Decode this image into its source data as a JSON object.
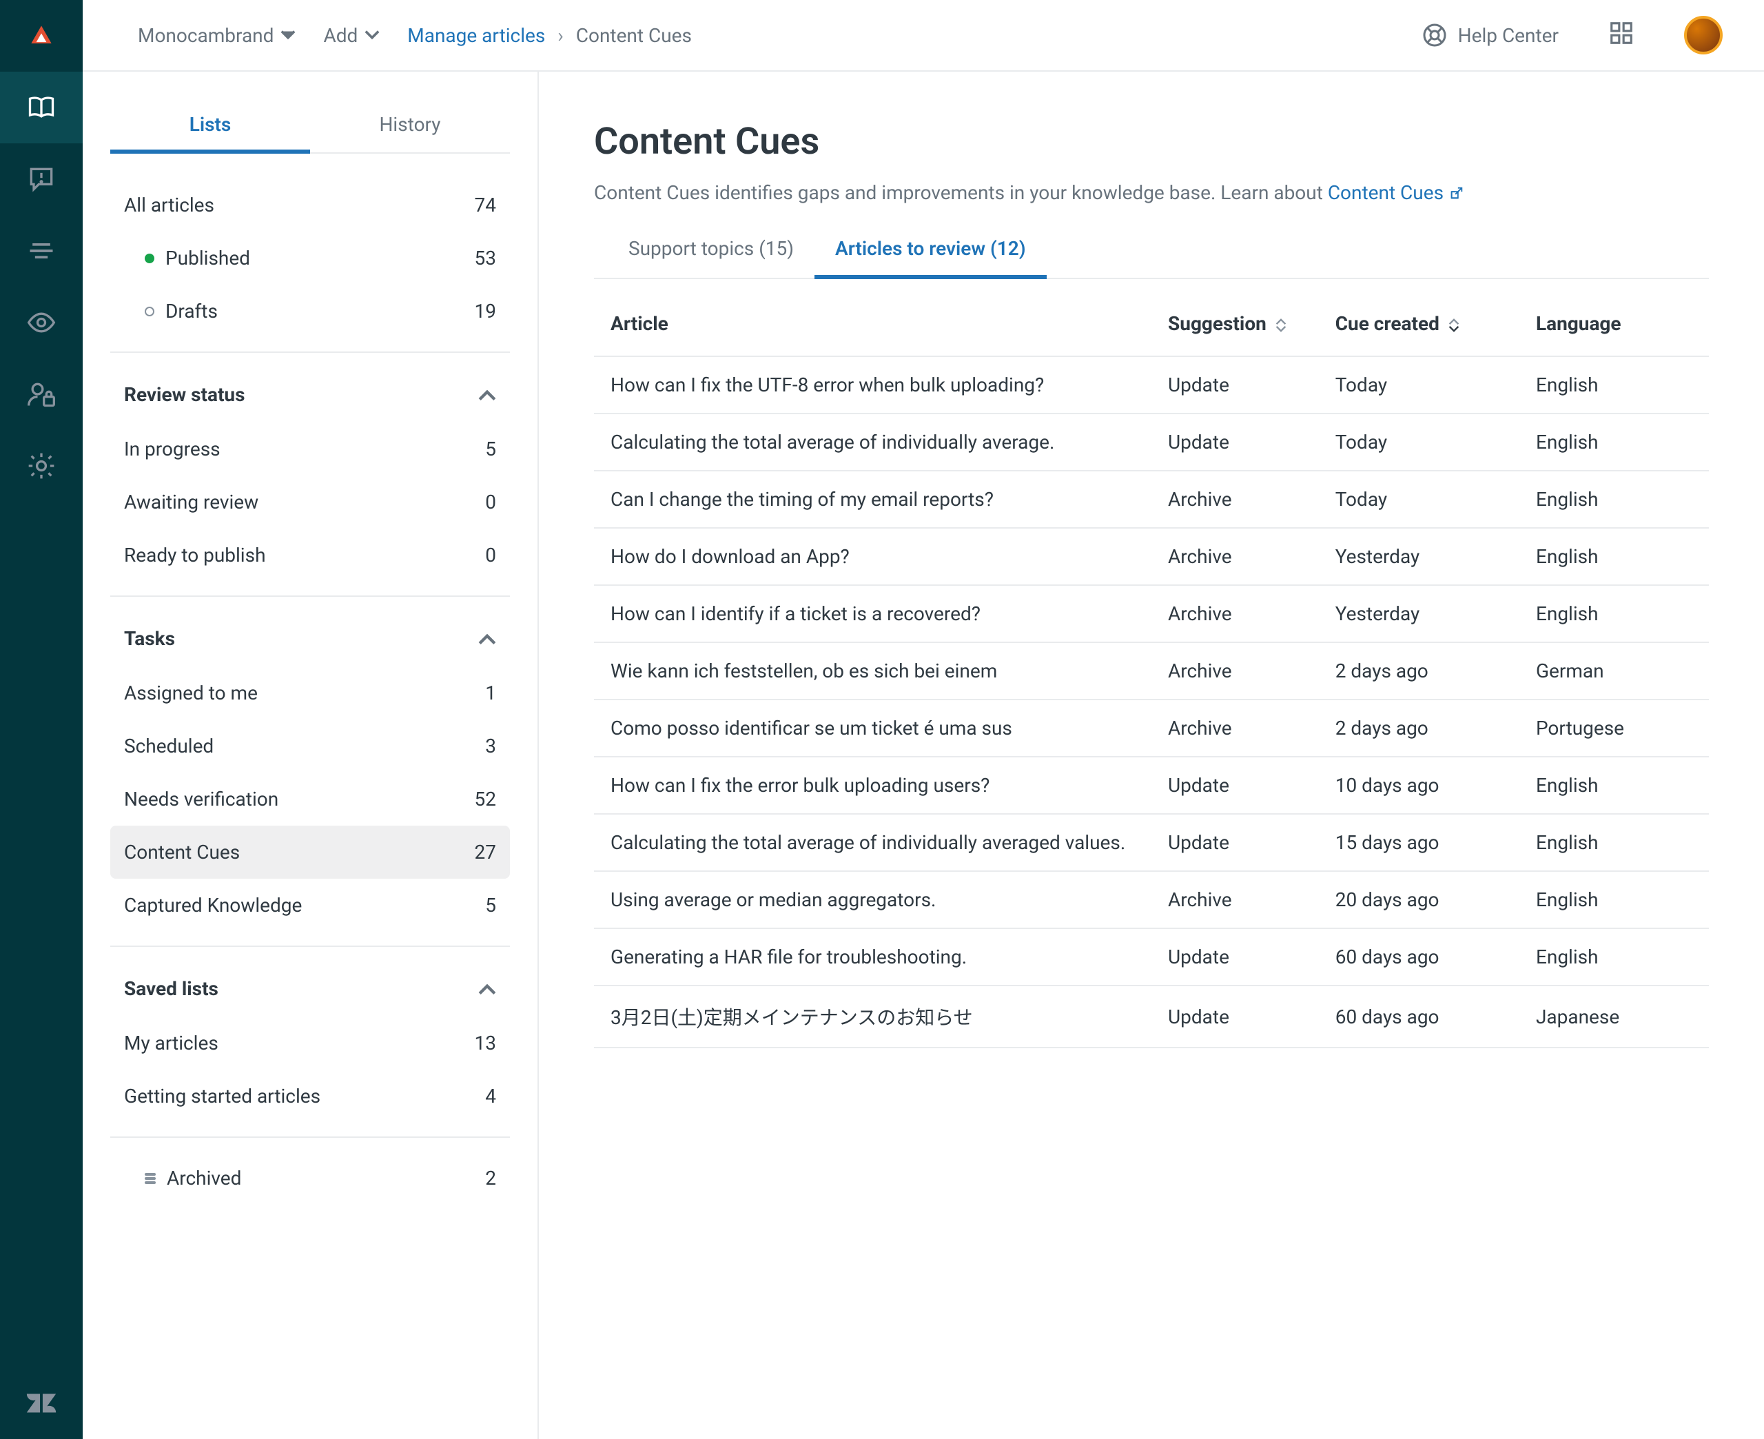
{
  "topbar": {
    "brand": "Monocambrand",
    "add_label": "Add",
    "breadcrumb_parent": "Manage articles",
    "breadcrumb_current": "Content Cues",
    "help_center": "Help Center"
  },
  "sidebar": {
    "tabs": {
      "lists": "Lists",
      "history": "History"
    },
    "all_articles": {
      "all": {
        "label": "All articles",
        "count": "74"
      },
      "published": {
        "label": "Published",
        "count": "53"
      },
      "drafts": {
        "label": "Drafts",
        "count": "19"
      }
    },
    "review_status": {
      "header": "Review status",
      "in_progress": {
        "label": "In progress",
        "count": "5"
      },
      "awaiting": {
        "label": "Awaiting review",
        "count": "0"
      },
      "ready": {
        "label": "Ready to publish",
        "count": "0"
      }
    },
    "tasks": {
      "header": "Tasks",
      "assigned": {
        "label": "Assigned to me",
        "count": "1"
      },
      "scheduled": {
        "label": "Scheduled",
        "count": "3"
      },
      "verification": {
        "label": "Needs verification",
        "count": "52"
      },
      "content_cues": {
        "label": "Content Cues",
        "count": "27"
      },
      "captured": {
        "label": "Captured Knowledge",
        "count": "5"
      }
    },
    "saved": {
      "header": "Saved lists",
      "my_articles": {
        "label": "My articles",
        "count": "13"
      },
      "getting_started": {
        "label": "Getting started articles",
        "count": "4"
      }
    },
    "archived": {
      "label": "Archived",
      "count": "2"
    }
  },
  "content": {
    "title": "Content Cues",
    "desc_prefix": "Content Cues identifies gaps and improvements in your knowledge base. Learn about ",
    "desc_link": "Content Cues",
    "tabs": {
      "support": "Support topics (15)",
      "review": "Articles to review (12)"
    },
    "columns": {
      "article": "Article",
      "suggestion": "Suggestion",
      "created": "Cue created",
      "language": "Language"
    },
    "rows": [
      {
        "article": "How can I fix the UTF-8 error when bulk uploading?",
        "suggestion": "Update",
        "created": "Today",
        "language": "English"
      },
      {
        "article": "Calculating the total average of individually average.",
        "suggestion": "Update",
        "created": "Today",
        "language": "English"
      },
      {
        "article": "Can I change the timing of my email reports?",
        "suggestion": "Archive",
        "created": "Today",
        "language": "English"
      },
      {
        "article": "How do I download an App?",
        "suggestion": "Archive",
        "created": "Yesterday",
        "language": "English"
      },
      {
        "article": "How can I identify if a ticket is a recovered?",
        "suggestion": "Archive",
        "created": "Yesterday",
        "language": "English"
      },
      {
        "article": "Wie kann ich feststellen, ob es sich bei einem",
        "suggestion": "Archive",
        "created": "2 days ago",
        "language": "German"
      },
      {
        "article": "Como posso identificar se um ticket é uma sus",
        "suggestion": "Archive",
        "created": "2 days ago",
        "language": "Portugese"
      },
      {
        "article": "How can I fix the error bulk uploading users?",
        "suggestion": "Update",
        "created": "10 days ago",
        "language": "English"
      },
      {
        "article": "Calculating the total average of individually averaged values.",
        "suggestion": "Update",
        "created": "15 days ago",
        "language": "English"
      },
      {
        "article": "Using average or median aggregators.",
        "suggestion": "Archive",
        "created": "20 days ago",
        "language": "English"
      },
      {
        "article": "Generating a HAR file for troubleshooting.",
        "suggestion": "Update",
        "created": "60 days ago",
        "language": "English"
      },
      {
        "article": "3月2日(土)定期メインテナンスのお知らせ",
        "suggestion": "Update",
        "created": "60 days ago",
        "language": "Japanese"
      }
    ]
  }
}
